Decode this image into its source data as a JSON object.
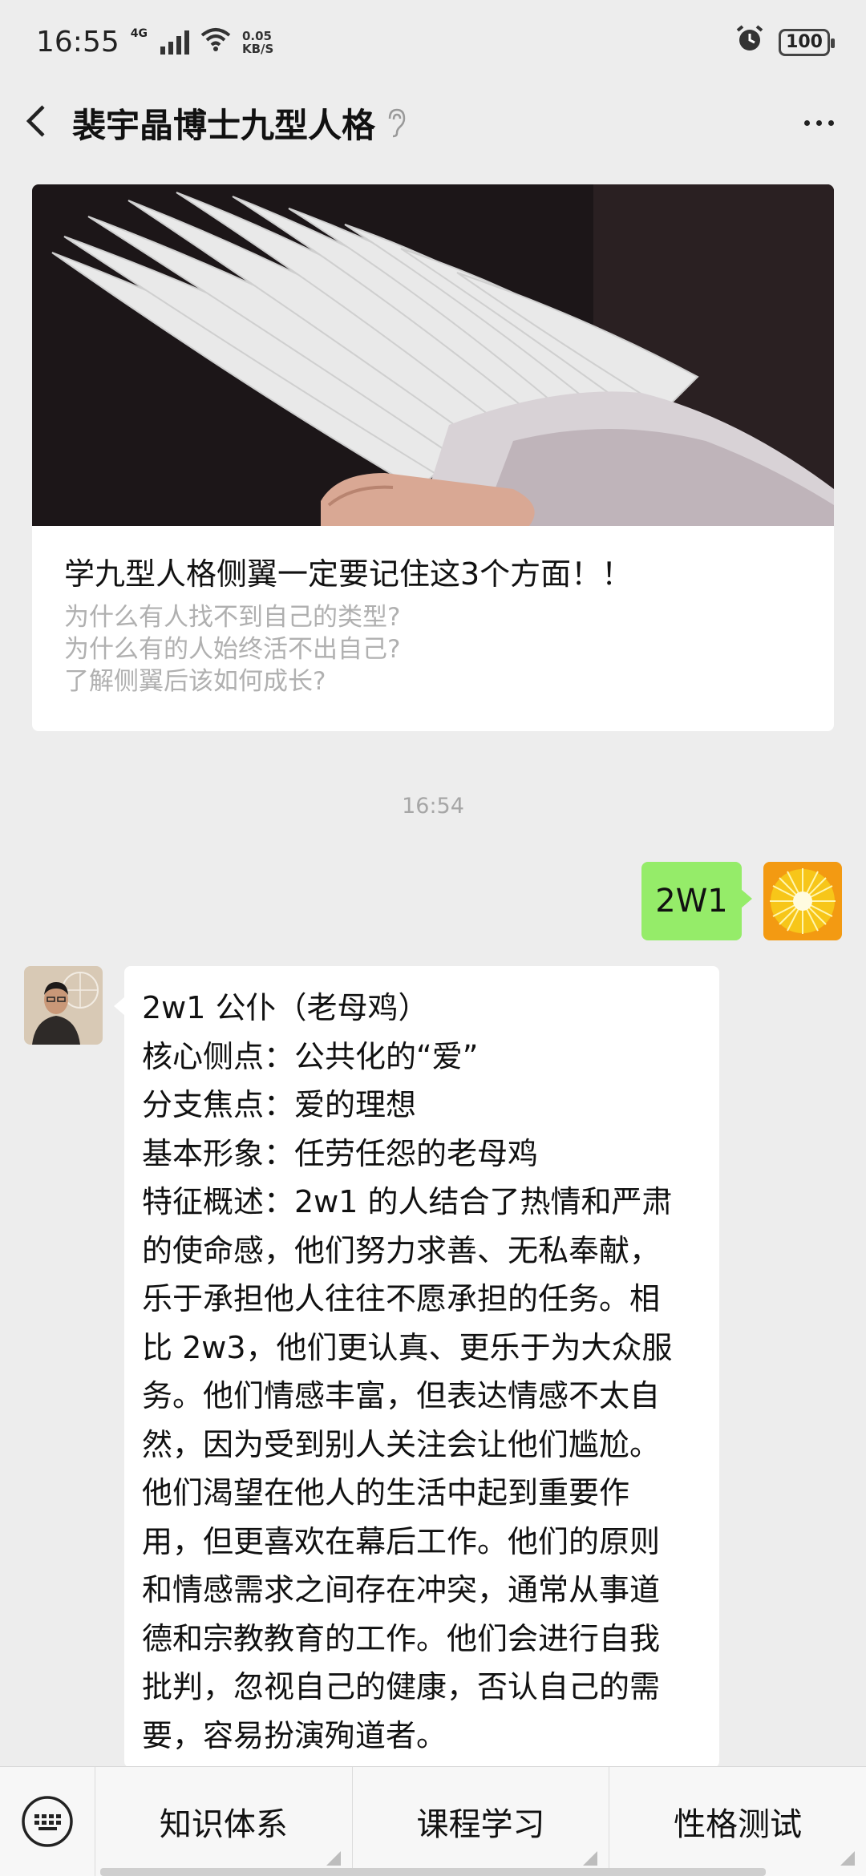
{
  "status_bar": {
    "time": "16:55",
    "network": "4G",
    "speed_value": "0.05",
    "speed_unit": "KB/S",
    "battery": "100"
  },
  "nav": {
    "title": "裴宇晶博士九型人格",
    "back_icon": "chevron-left-icon",
    "more_icon": "more-dots-icon",
    "ear_icon": "ear-icon"
  },
  "article": {
    "title": "学九型人格侧翼一定要记住这3个方面！！",
    "lines": [
      "为什么有人找不到自己的类型?",
      "为什么有的人始终活不出自己?",
      "了解侧翼后该如何成长?"
    ]
  },
  "timestamp": "16:54",
  "sent_message": "2W1",
  "received_message": {
    "lines": [
      "2w1  公仆（老母鸡）",
      "核心侧点：公共化的“爱”",
      "分支焦点：爱的理想",
      "基本形象：任劳任怨的老母鸡",
      "特征概述：2w1 的人结合了热情和严肃",
      "的使命感，他们努力求善、无私奉献，",
      "乐于承担他人往往不愿承担的任务。相",
      "比 2w3，他们更认真、更乐于为大众服",
      "务。他们情感丰富，但表达情感不太自",
      "然，因为受到别人关注会让他们尴尬。",
      "他们渴望在他人的生活中起到重要作",
      "用，但更喜欢在幕后工作。他们的原则",
      "和情感需求之间存在冲突，通常从事道",
      "德和宗教教育的工作。他们会进行自我",
      "批判，忽视自己的健康，否认自己的需",
      "要，容易扮演殉道者。"
    ]
  },
  "bottom_menu": {
    "keyboard_icon": "keyboard-icon",
    "items": [
      "知识体系",
      "课程学习",
      "性格测试"
    ]
  },
  "colors": {
    "background": "#ededed",
    "sent_bubble": "#95ec69",
    "received_bubble": "#ffffff",
    "secondary_text": "#b0b0b0"
  }
}
